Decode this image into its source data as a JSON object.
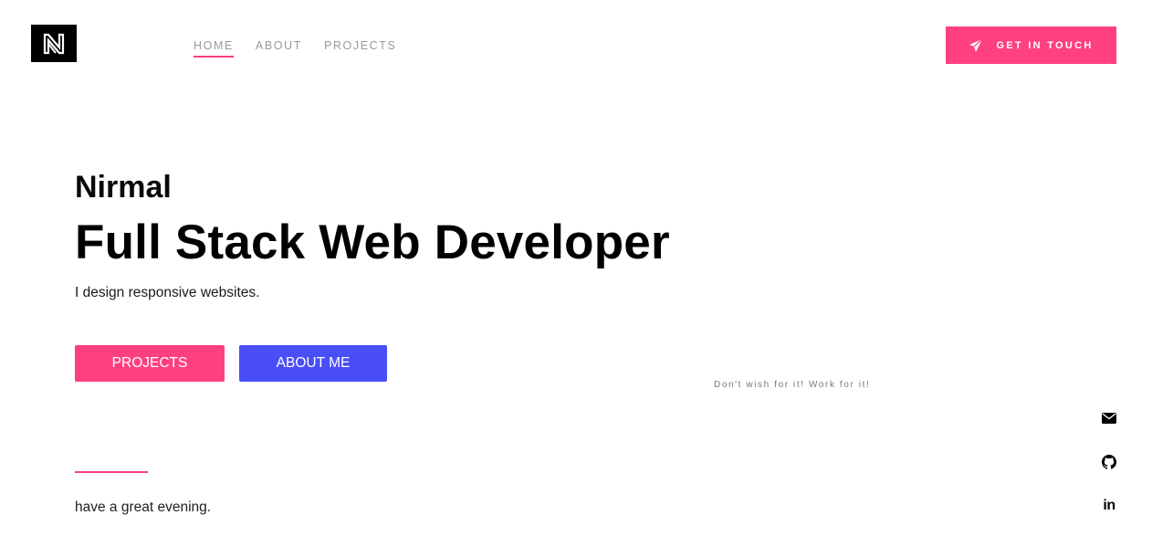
{
  "header": {
    "logo_alt": "N logo",
    "nav": [
      {
        "label": "HOME",
        "active": true
      },
      {
        "label": "ABOUT",
        "active": false
      },
      {
        "label": "PROJECTS",
        "active": false
      }
    ],
    "cta_label": "GET IN TOUCH",
    "cta_icon": "paper-plane-icon"
  },
  "hero": {
    "name": "Nirmal",
    "title": "Full Stack Web Developer",
    "subtitle": "I design responsive websites.",
    "buttons": {
      "projects": "PROJECTS",
      "about": "ABOUT ME"
    },
    "quote": "Don't wish for it! Work for it!",
    "greeting": "have a great evening."
  },
  "social": {
    "icons": [
      "envelope-icon",
      "github-icon",
      "linkedin-icon"
    ],
    "linkedin_glyph": "in"
  },
  "colors": {
    "accent_pink": "#ff4080",
    "accent_blue": "#4a4ef7",
    "nav_gray": "#9a9a9a",
    "logo_bg": "#000000"
  }
}
